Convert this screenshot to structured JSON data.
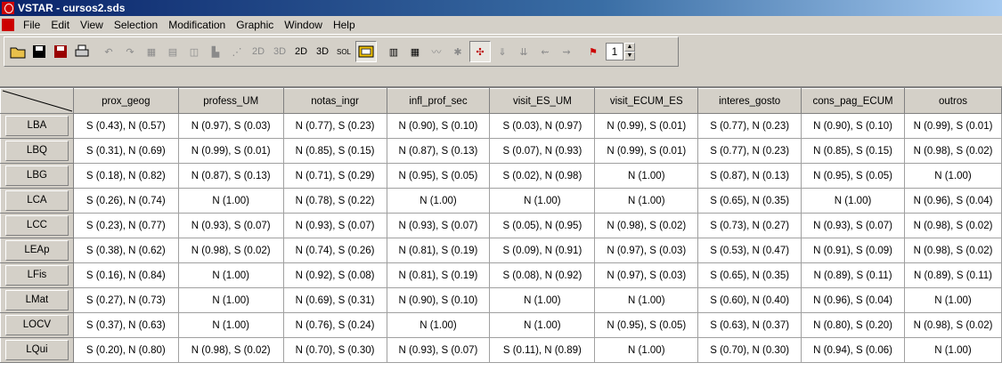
{
  "window": {
    "title": "VSTAR - cursos2.sds"
  },
  "menu": [
    "File",
    "Edit",
    "View",
    "Selection",
    "Modification",
    "Graphic",
    "Window",
    "Help"
  ],
  "toolbar": {
    "btn_2d_a": "2D",
    "btn_3d_a": "3D",
    "btn_2d_b": "2D",
    "btn_3d_b": "3D",
    "btn_sol": "SOL",
    "page_value": "1"
  },
  "table": {
    "columns": [
      "prox_geog",
      "profess_UM",
      "notas_ingr",
      "infl_prof_sec",
      "visit_ES_UM",
      "visit_ECUM_ES",
      "interes_gosto",
      "cons_pag_ECUM",
      "outros"
    ],
    "rows": [
      {
        "label": "LBA",
        "cells": [
          "S (0.43), N (0.57)",
          "N (0.97), S (0.03)",
          "N (0.77), S (0.23)",
          "N (0.90), S (0.10)",
          "S (0.03), N (0.97)",
          "N (0.99), S (0.01)",
          "S (0.77), N (0.23)",
          "N (0.90), S (0.10)",
          "N (0.99), S (0.01)"
        ]
      },
      {
        "label": "LBQ",
        "cells": [
          "S (0.31), N (0.69)",
          "N (0.99), S (0.01)",
          "N (0.85), S (0.15)",
          "N (0.87), S (0.13)",
          "S (0.07), N (0.93)",
          "N (0.99), S (0.01)",
          "S (0.77), N (0.23)",
          "N (0.85), S (0.15)",
          "N (0.98), S (0.02)"
        ]
      },
      {
        "label": "LBG",
        "cells": [
          "S (0.18), N (0.82)",
          "N (0.87), S (0.13)",
          "N (0.71), S (0.29)",
          "N (0.95), S (0.05)",
          "S (0.02), N (0.98)",
          "N (1.00)",
          "S (0.87), N (0.13)",
          "N (0.95), S (0.05)",
          "N (1.00)"
        ]
      },
      {
        "label": "LCA",
        "cells": [
          "S (0.26), N (0.74)",
          "N (1.00)",
          "N (0.78), S (0.22)",
          "N (1.00)",
          "N (1.00)",
          "N (1.00)",
          "S (0.65), N (0.35)",
          "N (1.00)",
          "N (0.96), S (0.04)"
        ]
      },
      {
        "label": "LCC",
        "cells": [
          "S (0.23), N (0.77)",
          "N (0.93), S (0.07)",
          "N (0.93), S (0.07)",
          "N (0.93), S (0.07)",
          "S (0.05), N (0.95)",
          "N (0.98), S (0.02)",
          "S (0.73), N (0.27)",
          "N (0.93), S (0.07)",
          "N (0.98), S (0.02)"
        ]
      },
      {
        "label": "LEAp",
        "cells": [
          "S (0.38), N (0.62)",
          "N (0.98), S (0.02)",
          "N (0.74), S (0.26)",
          "N (0.81), S (0.19)",
          "S (0.09), N (0.91)",
          "N (0.97), S (0.03)",
          "S (0.53), N (0.47)",
          "N (0.91), S (0.09)",
          "N (0.98), S (0.02)"
        ]
      },
      {
        "label": "LFis",
        "cells": [
          "S (0.16), N (0.84)",
          "N (1.00)",
          "N (0.92), S (0.08)",
          "N (0.81), S (0.19)",
          "S (0.08), N (0.92)",
          "N (0.97), S (0.03)",
          "S (0.65), N (0.35)",
          "N (0.89), S (0.11)",
          "N (0.89), S (0.11)"
        ]
      },
      {
        "label": "LMat",
        "cells": [
          "S (0.27), N (0.73)",
          "N (1.00)",
          "N (0.69), S (0.31)",
          "N (0.90), S (0.10)",
          "N (1.00)",
          "N (1.00)",
          "S (0.60), N (0.40)",
          "N (0.96), S (0.04)",
          "N (1.00)"
        ]
      },
      {
        "label": "LOCV",
        "cells": [
          "S (0.37), N (0.63)",
          "N (1.00)",
          "N (0.76), S (0.24)",
          "N (1.00)",
          "N (1.00)",
          "N (0.95), S (0.05)",
          "S (0.63), N (0.37)",
          "N (0.80), S (0.20)",
          "N (0.98), S (0.02)"
        ]
      },
      {
        "label": "LQui",
        "cells": [
          "S (0.20), N (0.80)",
          "N (0.98), S (0.02)",
          "N (0.70), S (0.30)",
          "N (0.93), S (0.07)",
          "S (0.11), N (0.89)",
          "N (1.00)",
          "S (0.70), N (0.30)",
          "N (0.94), S (0.06)",
          "N (1.00)"
        ]
      }
    ]
  }
}
